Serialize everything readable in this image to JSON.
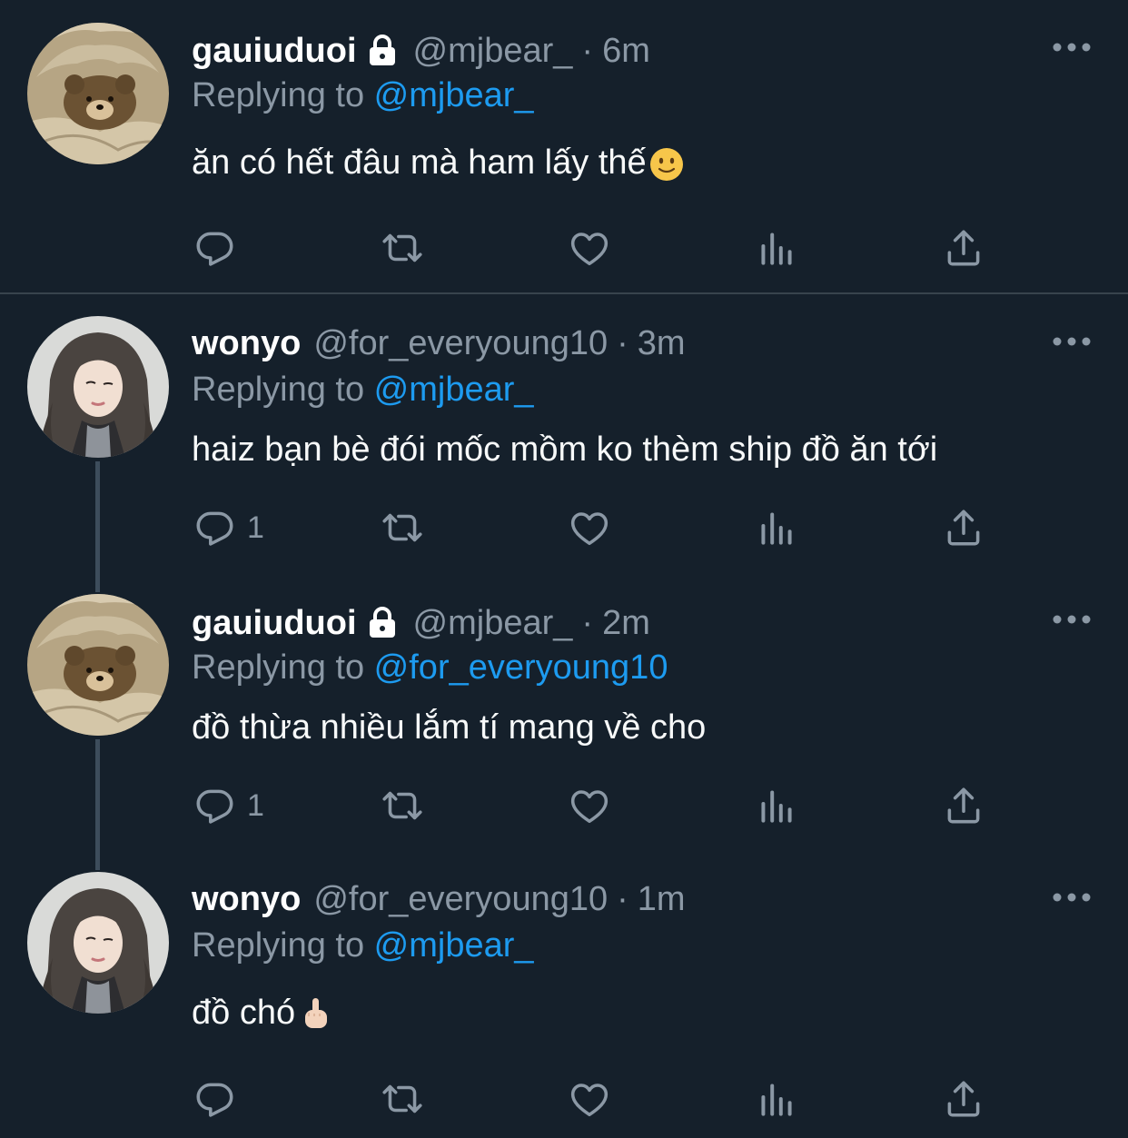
{
  "tweets": [
    {
      "name": "gauiuduoi",
      "handle": "@mjbear_",
      "sep": "·",
      "time": "6m",
      "replying_prefix": "Replying to ",
      "replying_to": "@mjbear_",
      "text": "ăn có hết đâu mà ham lấy thế",
      "emoji": "slightly-smiling-face",
      "reply_count": ""
    },
    {
      "name": "wonyo",
      "handle": "@for_everyoung10",
      "sep": "·",
      "time": "3m",
      "replying_prefix": "Replying to ",
      "replying_to": "@mjbear_",
      "text": "haiz bạn bè đói mốc mồm ko thèm ship đồ ăn tới",
      "reply_count": "1"
    },
    {
      "name": "gauiuduoi",
      "handle": "@mjbear_",
      "sep": "·",
      "time": "2m",
      "replying_prefix": "Replying to ",
      "replying_to": "@for_everyoung10",
      "text": "đồ thừa nhiều lắm tí mang về cho",
      "reply_count": "1"
    },
    {
      "name": "wonyo",
      "handle": "@for_everyoung10",
      "sep": "·",
      "time": "1m",
      "replying_prefix": "Replying to ",
      "replying_to": "@mjbear_",
      "text": "đồ chó",
      "emoji": "middle-finger",
      "reply_count": ""
    }
  ],
  "icons": [
    "reply-icon",
    "retweet-icon",
    "like-icon",
    "analytics-icon",
    "share-icon",
    "more-icon",
    "lock-icon"
  ],
  "colors": {
    "background": "#15202b",
    "secondary_text": "#8b98a5",
    "mention": "#1d9bf0",
    "thread_line": "#3d4d5c"
  }
}
